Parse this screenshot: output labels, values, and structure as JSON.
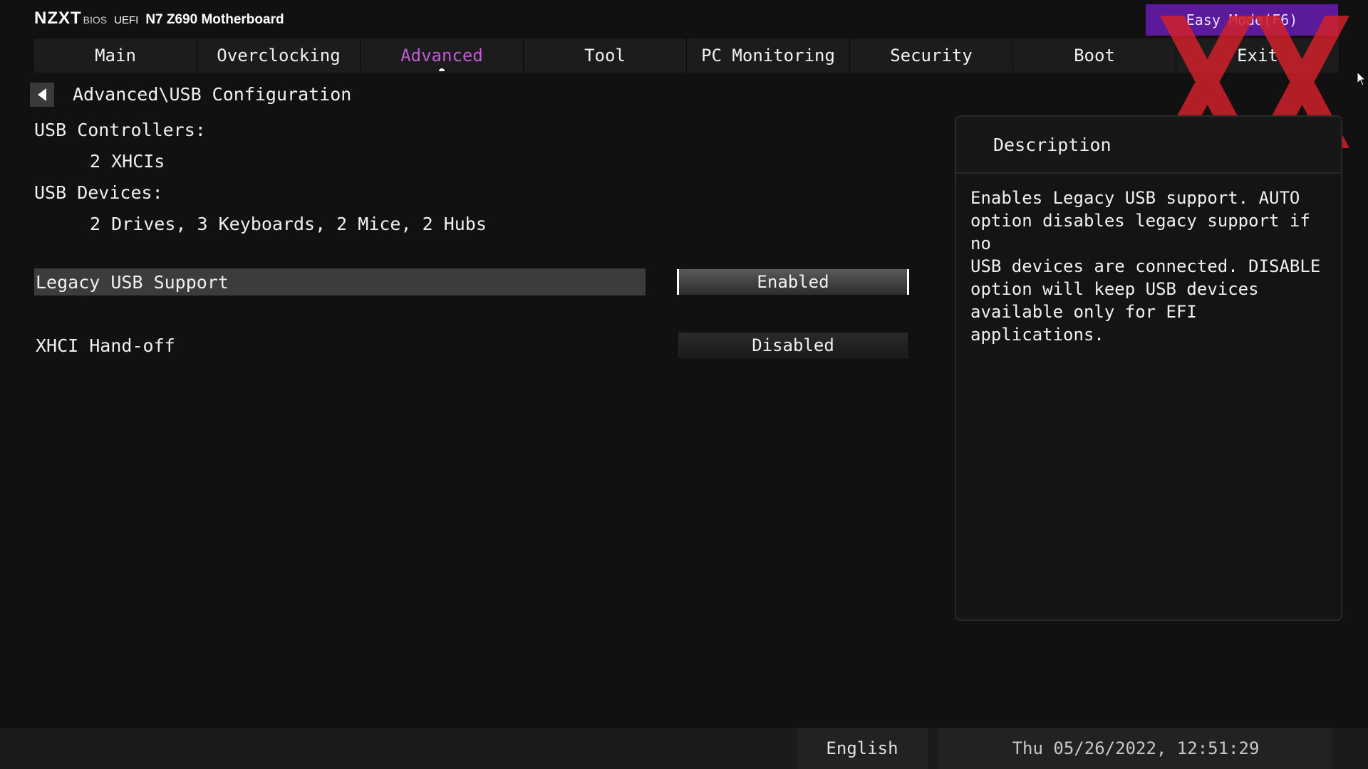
{
  "header": {
    "brand": "NZXT",
    "bios_tag": "BIOS",
    "uefi_tag": "UEFI",
    "board_name": "N7 Z690 Motherboard",
    "easy_mode_label": "Easy Mode(F6)"
  },
  "tabs": [
    {
      "label": "Main",
      "active": false
    },
    {
      "label": "Overclocking",
      "active": false
    },
    {
      "label": "Advanced",
      "active": true
    },
    {
      "label": "Tool",
      "active": false
    },
    {
      "label": "PC Monitoring",
      "active": false
    },
    {
      "label": "Security",
      "active": false
    },
    {
      "label": "Boot",
      "active": false
    },
    {
      "label": "Exit",
      "active": false
    }
  ],
  "breadcrumb": "Advanced\\USB Configuration",
  "info": {
    "usb_controllers_label": "USB Controllers:",
    "usb_controllers_value": "2 XHCIs",
    "usb_devices_label": "USB Devices:",
    "usb_devices_value": "2 Drives, 3 Keyboards, 2 Mice, 2 Hubs"
  },
  "settings": [
    {
      "label": "Legacy USB Support",
      "value": "Enabled",
      "selected": true
    },
    {
      "label": "XHCI Hand-off",
      "value": "Disabled",
      "selected": false
    }
  ],
  "description": {
    "title": "Description",
    "text": "Enables Legacy USB support. AUTO\noption disables legacy support if no\nUSB devices are connected. DISABLE\noption will keep USB devices\navailable only for EFI applications."
  },
  "footer": {
    "language": "English",
    "datetime": "Thu 05/26/2022, 12:51:29"
  },
  "colors": {
    "accent": "#c25bd6",
    "easy_mode_bg": "#5a1a9a",
    "logo_red": "#d0202a"
  },
  "icons": {
    "back": "triangle-left-icon",
    "logo": "xx-logo-icon",
    "cursor": "mouse-cursor-icon"
  }
}
